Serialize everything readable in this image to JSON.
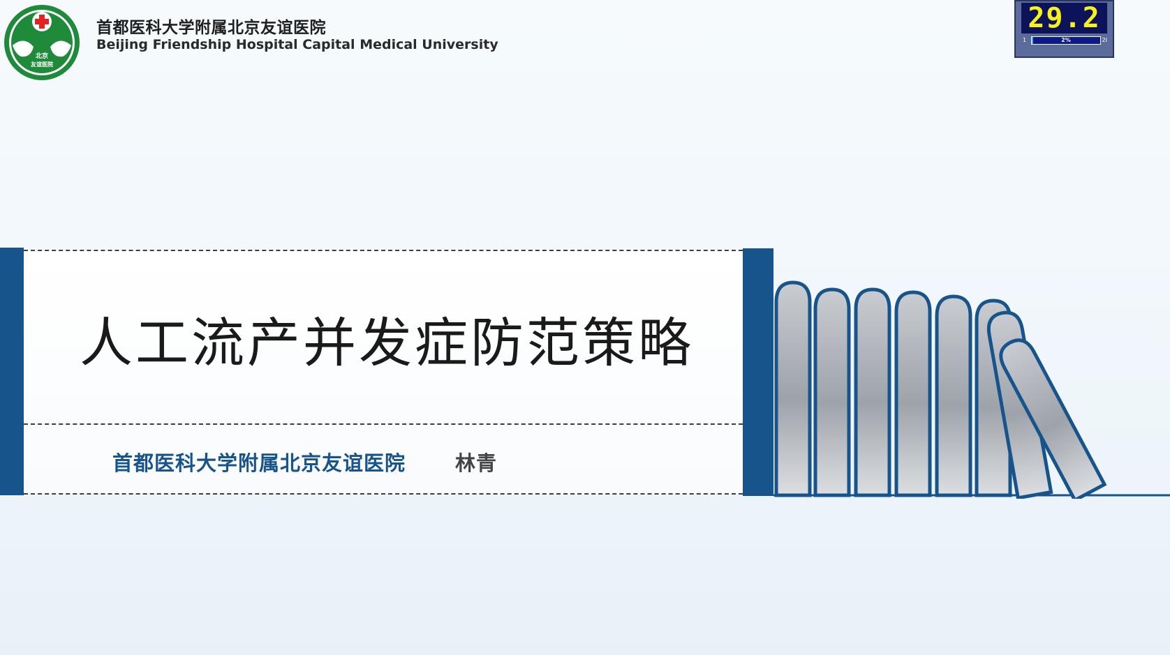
{
  "header": {
    "hospital_name_cn": "首都医科大学附属北京友谊医院",
    "hospital_name_en": "Beijing Friendship Hospital Capital Medical University",
    "logo": {
      "icon": "red-cross-dove-emblem-icon",
      "inner_text": [
        "北京",
        "友谊医院"
      ],
      "colors": {
        "ring": "#1f8a3a",
        "cross": "#e32222",
        "dove": "#ffffff"
      }
    }
  },
  "timer": {
    "display": "29.2",
    "min_label": "1",
    "max_label": "2I",
    "progress_label": "2%",
    "progress_fraction": 0.02,
    "colors": {
      "digits": "#f7f21a",
      "screen": "#0c1358",
      "frame": "#5b6b9c"
    }
  },
  "slide": {
    "title": "人工流产并发症防范策略",
    "presenter_org": "首都医科大学附属北京友谊医院",
    "presenter_name": "林青",
    "colors": {
      "accent": "#17548b",
      "title_text": "#1a1a1a",
      "book": "#9a9fa6"
    },
    "decoration": "falling-books-icon"
  }
}
